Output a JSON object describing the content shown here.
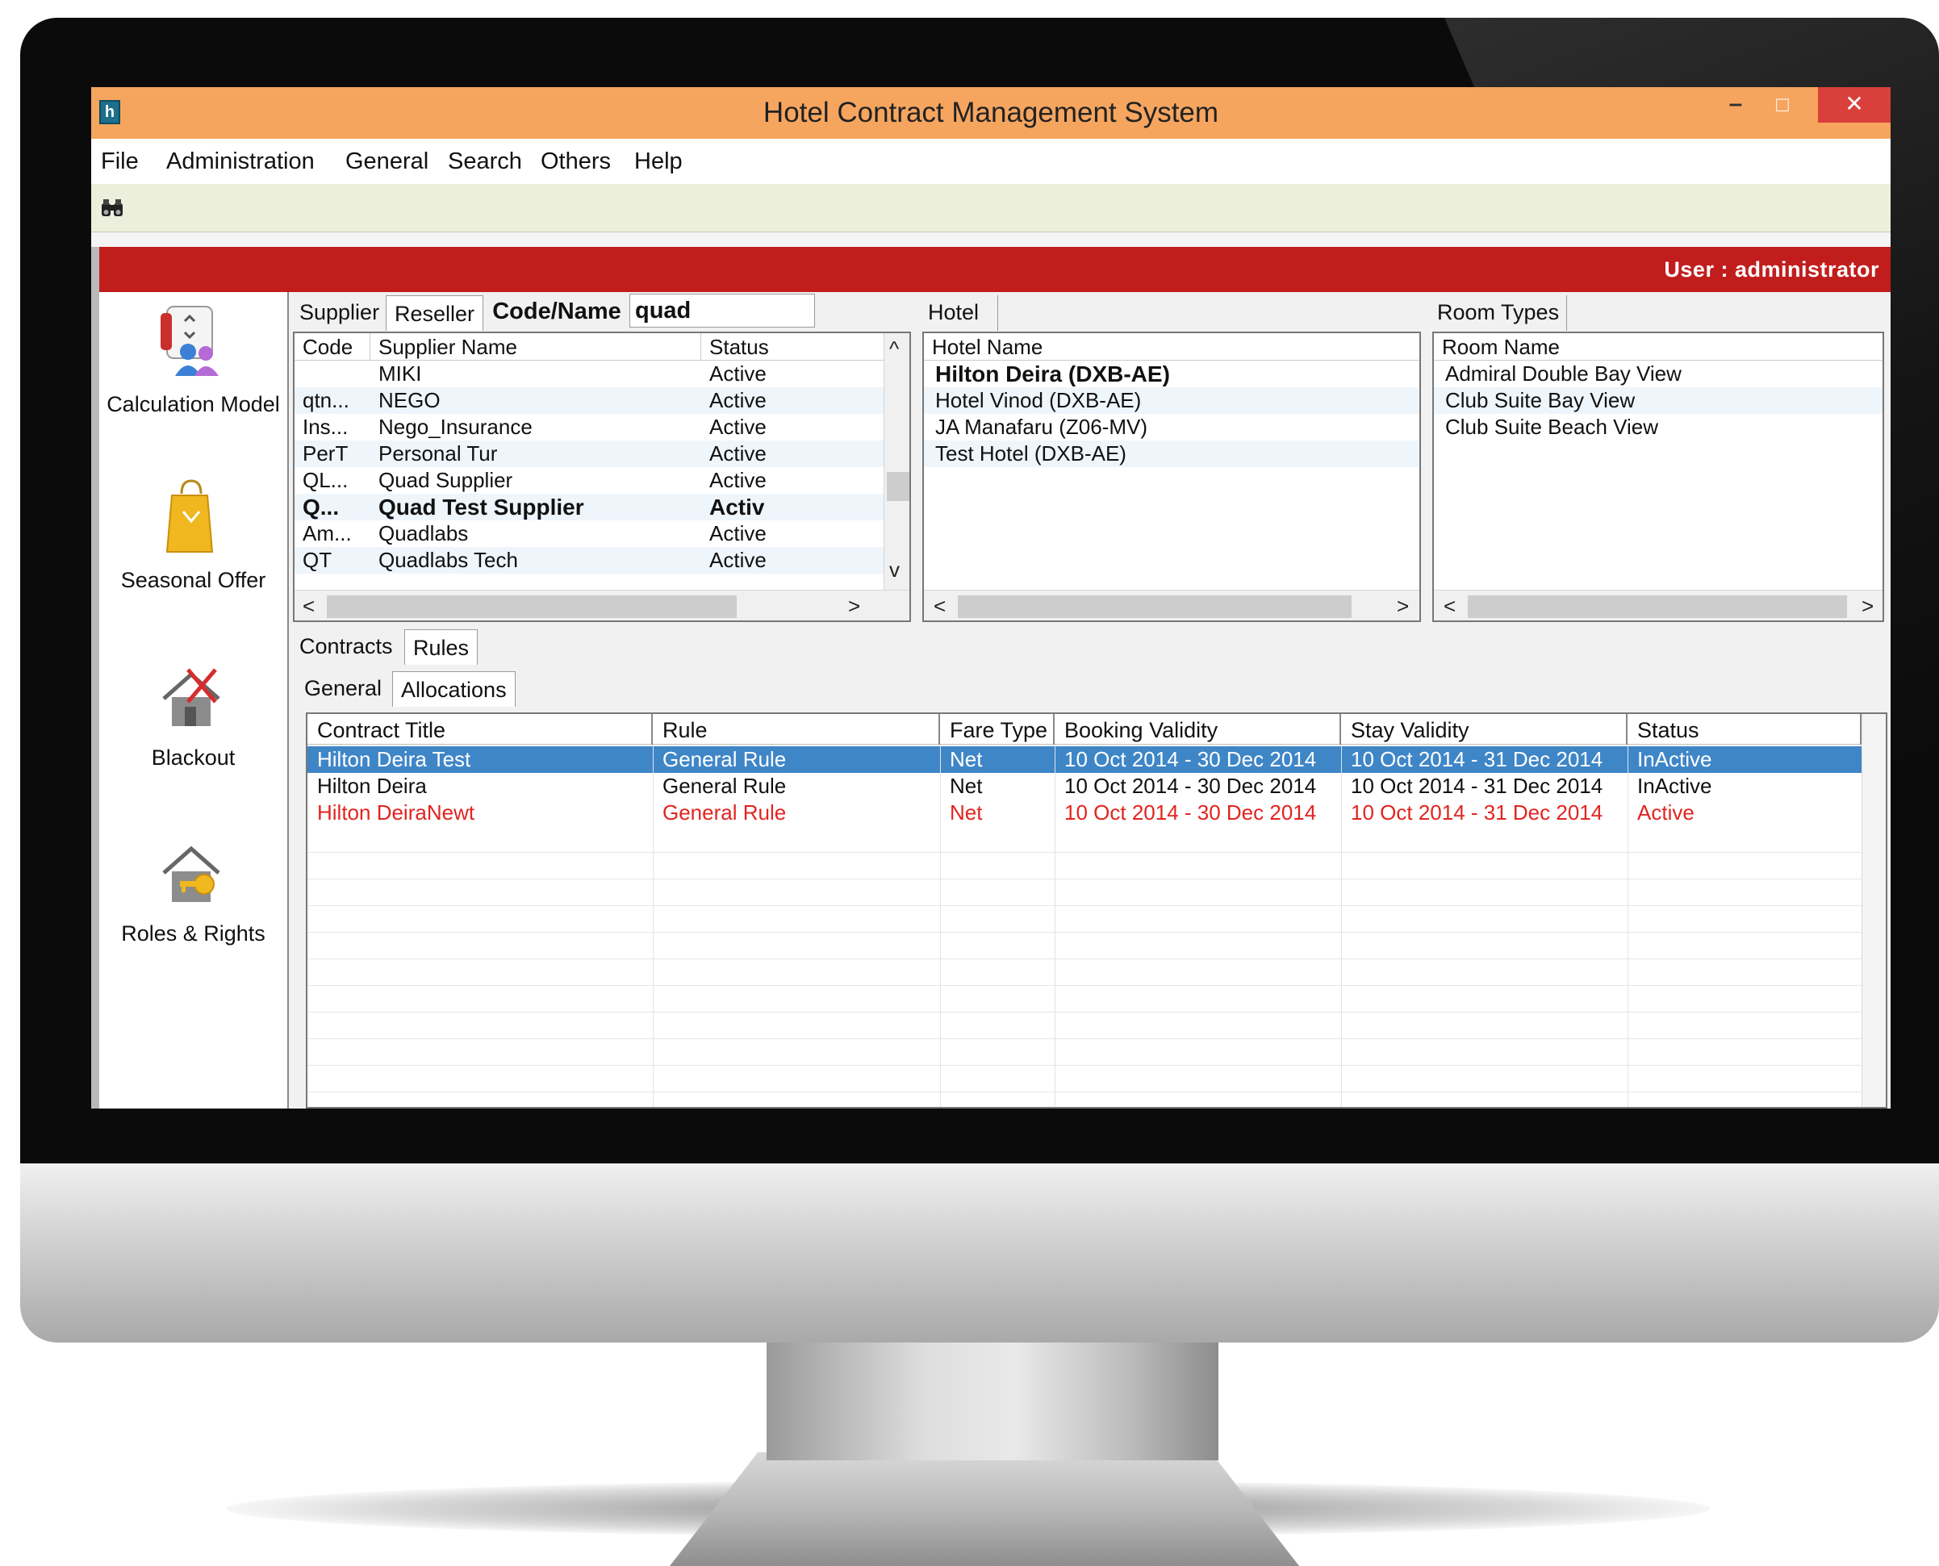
{
  "window": {
    "title": "Hotel Contract Management  System",
    "app_icon": "h",
    "minimize": "–",
    "maximize": "□",
    "close": "✕"
  },
  "menu": [
    "File",
    "Administration",
    "General",
    "Search",
    "Others",
    "Help"
  ],
  "toolbar": {
    "find_icon": "binoculars-icon"
  },
  "user_bar": {
    "text": "User : administrator"
  },
  "nav": [
    {
      "label": "Calculation Model",
      "icon": "calculation-model-icon"
    },
    {
      "label": "Seasonal Offer",
      "icon": "shopping-bag-icon"
    },
    {
      "label": "Blackout",
      "icon": "blackout-house-icon"
    },
    {
      "label": "Roles & Rights",
      "icon": "house-key-icon"
    }
  ],
  "supplier_panel": {
    "tabs": [
      "Supplier",
      "Reseller"
    ],
    "search_label": "Code/Name",
    "search_value": "quad",
    "columns": [
      "Code",
      "Supplier Name",
      "Status"
    ],
    "rows": [
      {
        "code": "",
        "name": "MIKI",
        "status": "Active"
      },
      {
        "code": "qtn...",
        "name": "NEGO",
        "status": "Active"
      },
      {
        "code": "Ins...",
        "name": "Nego_Insurance",
        "status": "Active"
      },
      {
        "code": "PerT",
        "name": "Personal Tur",
        "status": "Active"
      },
      {
        "code": "QL...",
        "name": "Quad Supplier",
        "status": "Active"
      },
      {
        "code": "Q...",
        "name": "Quad Test Supplier",
        "status": "Activ"
      },
      {
        "code": "Am...",
        "name": "Quadlabs",
        "status": "Active"
      },
      {
        "code": "QT",
        "name": "Quadlabs Tech",
        "status": "Active"
      }
    ]
  },
  "hotel_panel": {
    "tab": "Hotel",
    "column": "Hotel Name",
    "rows": [
      "Hilton Deira  (DXB-AE)",
      "Hotel Vinod  (DXB-AE)",
      "JA Manafaru  (Z06-MV)",
      "Test Hotel  (DXB-AE)"
    ]
  },
  "room_panel": {
    "tab": "Room Types",
    "column": "Room Name",
    "rows": [
      "Admiral Double Bay View",
      "Club Suite Bay View",
      "Club Suite Beach View"
    ]
  },
  "contracts": {
    "tabs": [
      "Contracts",
      "Rules"
    ],
    "subtabs": [
      "General",
      "Allocations"
    ],
    "columns": [
      "Contract Title",
      "Rule",
      "Fare Type",
      "Booking Validity",
      "Stay Validity",
      "Status"
    ],
    "rows": [
      {
        "title": "Hilton Deira Test",
        "rule": "General Rule",
        "fare": "Net",
        "booking": "10 Oct 2014 - 30 Dec 2014",
        "stay": "10 Oct 2014 - 31 Dec 2014",
        "status": "InActive"
      },
      {
        "title": "Hilton Deira",
        "rule": "General Rule",
        "fare": "Net",
        "booking": "10 Oct 2014 - 30 Dec 2014",
        "stay": "10 Oct 2014 - 31 Dec 2014",
        "status": "InActive"
      },
      {
        "title": "Hilton DeiraNewt",
        "rule": "General Rule",
        "fare": "Net",
        "booking": "10 Oct 2014 - 30 Dec 2014",
        "stay": "10 Oct 2014 - 31 Dec 2014",
        "status": "Active"
      }
    ]
  },
  "colors": {
    "titlebar": "#f6a55f",
    "userbar": "#c21d1d",
    "selection": "#3f86c7",
    "active_contract_text": "#e2241f"
  }
}
